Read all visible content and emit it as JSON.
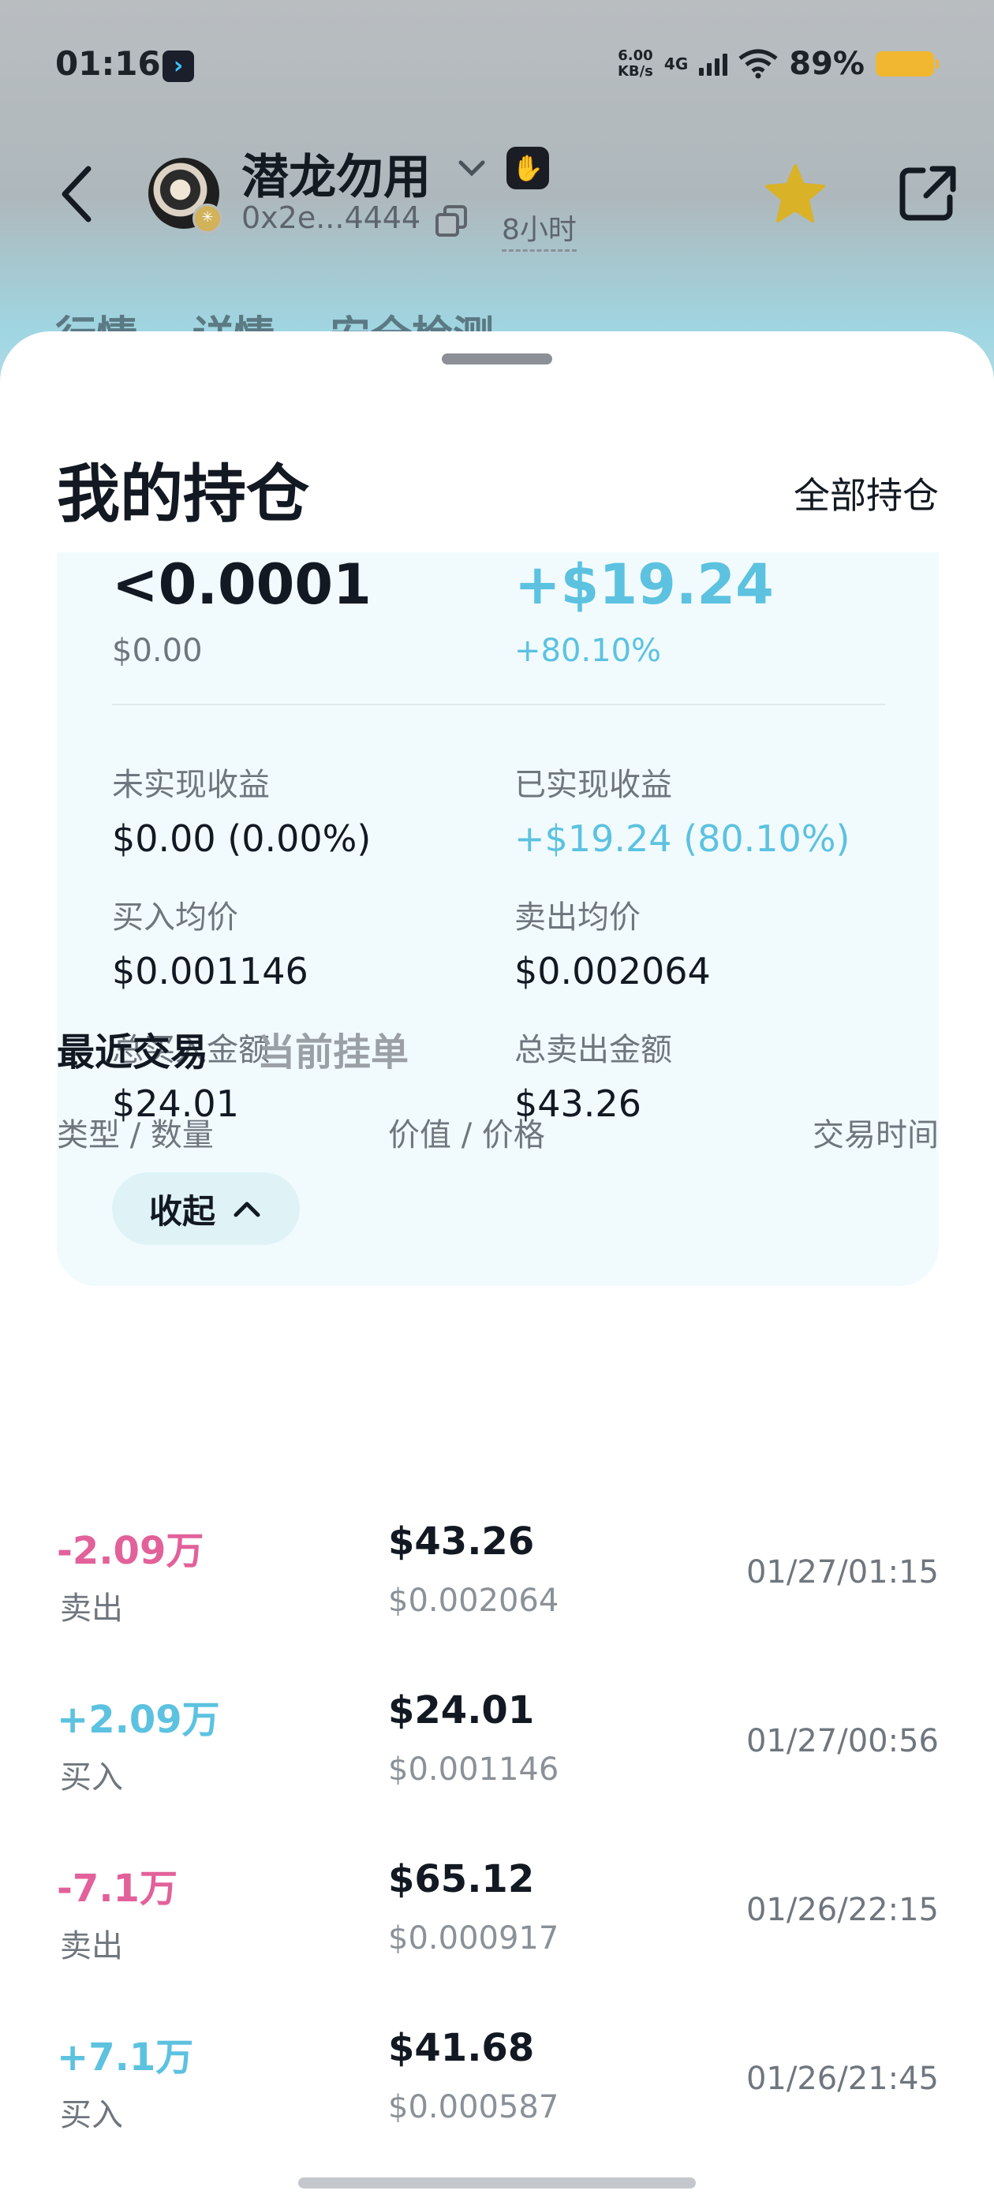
{
  "status_bar": {
    "time": "01:16",
    "app_icon": "arrow-app-icon",
    "net_speed_value": "6.00",
    "net_speed_unit": "KB/s",
    "network": "4G",
    "battery": "89%",
    "battery_color": "#f1b730"
  },
  "token": {
    "name": "潜龙勿用",
    "address": "0x2e...4444",
    "age": "8小时",
    "logo_icon": "dragon-logo-icon",
    "favorite_color": "#d9b228"
  },
  "page_tabs_behind": [
    "行情",
    "详情",
    "安全检测"
  ],
  "sheet": {
    "title": "我的持仓",
    "all_holdings_link": "全部持仓",
    "balance": {
      "amount": "<0.0001",
      "value": "$0.00"
    },
    "pnl": {
      "amount": "+$19.24",
      "percent": "+80.10%"
    },
    "stats": {
      "unrealized": {
        "label": "未实现收益",
        "value": "$0.00 (0.00%)"
      },
      "realized": {
        "label": "已实现收益",
        "value": "+$19.24 (80.10%)"
      },
      "avg_buy": {
        "label": "买入均价",
        "value": "$0.001146"
      },
      "avg_sell": {
        "label": "卖出均价",
        "value": "$0.002064"
      },
      "total_buy": {
        "label": "总买入金额",
        "value": "$24.01"
      },
      "total_sell": {
        "label": "总卖出金额",
        "value": "$43.26"
      }
    },
    "collapse_label": "收起",
    "trade_tabs": [
      "最近交易",
      "当前挂单"
    ],
    "columns": {
      "type_qty": "类型 / 数量",
      "value_price": "价值 / 价格",
      "time": "交易时间"
    },
    "trades": [
      {
        "qty": "-2.09万",
        "side": "卖出",
        "value": "$43.26",
        "price": "$0.002064",
        "time": "01/27/01:15",
        "direction": "neg"
      },
      {
        "qty": "+2.09万",
        "side": "买入",
        "value": "$24.01",
        "price": "$0.001146",
        "time": "01/27/00:56",
        "direction": "pos"
      },
      {
        "qty": "-7.1万",
        "side": "卖出",
        "value": "$65.12",
        "price": "$0.000917",
        "time": "01/26/22:15",
        "direction": "neg"
      },
      {
        "qty": "+7.1万",
        "side": "买入",
        "value": "$41.68",
        "price": "$0.000587",
        "time": "01/26/21:45",
        "direction": "pos"
      }
    ],
    "colors": {
      "positive": "#5cc2e0",
      "negative": "#e2619a"
    }
  }
}
